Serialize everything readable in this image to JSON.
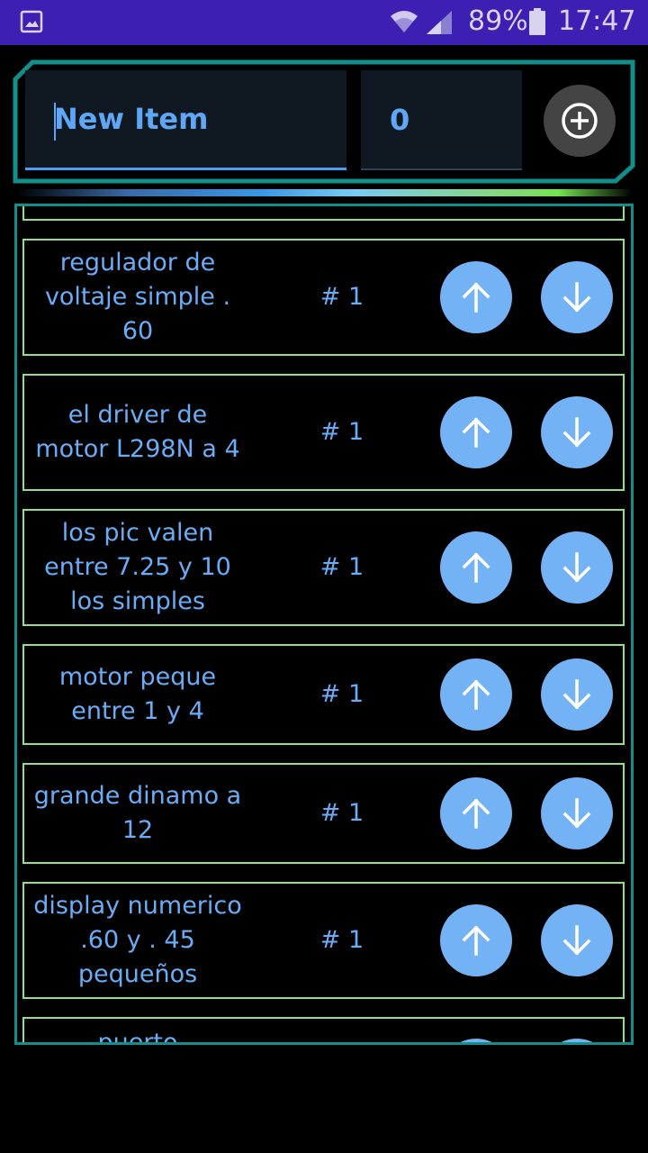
{
  "status_bar": {
    "battery_percent": "89%",
    "time": "17:47",
    "icons": [
      "gallery-icon",
      "wifi-icon",
      "signal-icon",
      "battery-icon"
    ]
  },
  "entry": {
    "item_placeholder": "New Item",
    "quantity_value": "0",
    "add_button_icon": "add-circle-icon"
  },
  "items": [
    {
      "name": "",
      "qty": ""
    },
    {
      "name": "regulador de voltaje simple . 60",
      "qty": "# 1"
    },
    {
      "name": "el driver de motor L298N a 4",
      "qty": "# 1"
    },
    {
      "name": "los pic valen entre 7.25 y 10 los simples",
      "qty": "# 1"
    },
    {
      "name": "motor peque entre 1 y 4",
      "qty": "# 1"
    },
    {
      "name": "grande dinamo a 12",
      "qty": "# 1"
    },
    {
      "name": "display numerico .60 y . 45 pequeños",
      "qty": "# 1"
    },
    {
      "name": "puerto",
      "qty": ""
    }
  ],
  "colors": {
    "status_bar": "#3c1fb3",
    "accent_blue": "#6aadf7",
    "row_border": "#93e07f",
    "frame_teal": "#128f8a",
    "button_blue": "#73b2f4"
  }
}
